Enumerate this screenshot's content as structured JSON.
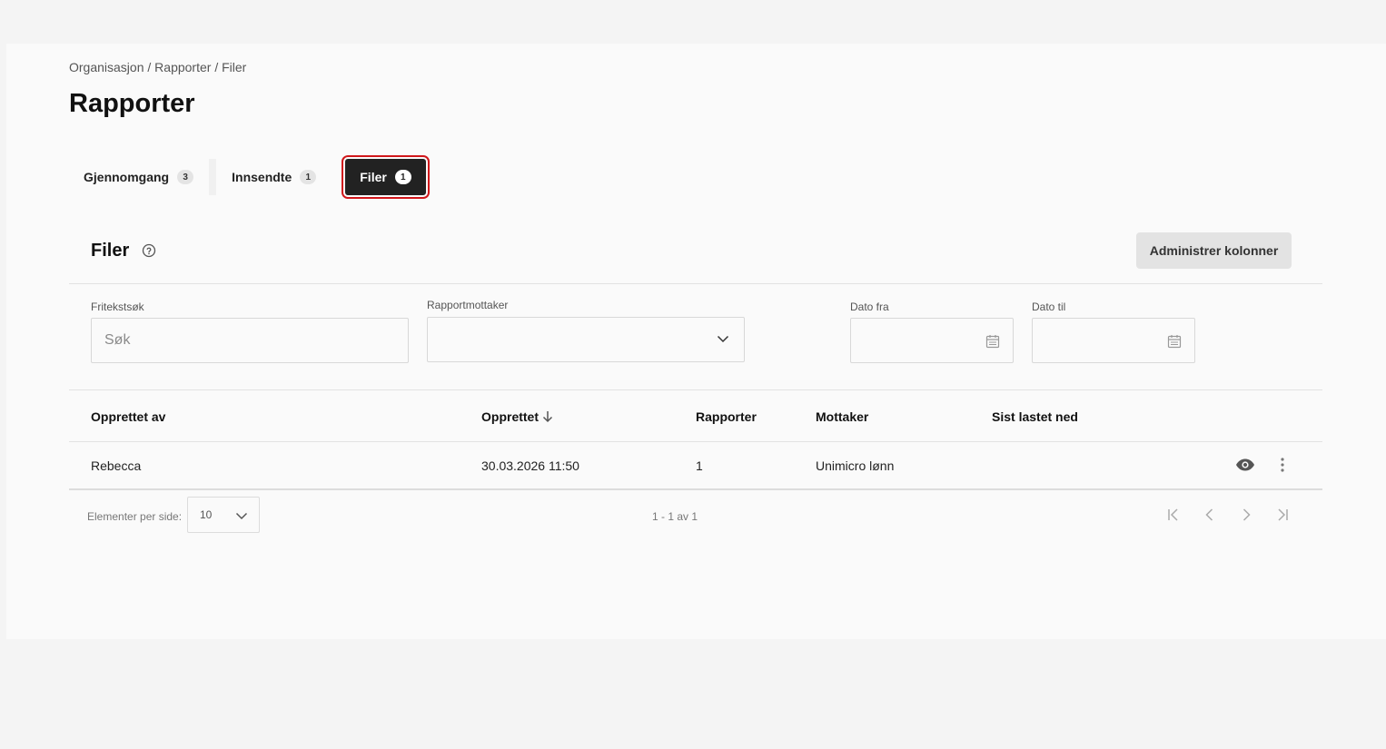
{
  "breadcrumb": [
    "Organisasjon",
    "Rapporter",
    "Filer"
  ],
  "breadcrumb_sep": " / ",
  "page_title": "Rapporter",
  "tabs": [
    {
      "label": "Gjennomgang",
      "count": "3"
    },
    {
      "label": "Innsendte",
      "count": "1"
    },
    {
      "label": "Filer",
      "count": "1",
      "active": true
    }
  ],
  "card": {
    "title": "Filer",
    "help_icon": "question-circle-icon",
    "admin_button": "Administrer kolonner"
  },
  "filters": {
    "search_label": "Fritekstsøk",
    "search_placeholder": "Søk",
    "recipient_label": "Rapportmottaker",
    "recipient_value": "",
    "date_from_label": "Dato fra",
    "date_to_label": "Dato til"
  },
  "table": {
    "columns": [
      "Opprettet av",
      "Opprettet",
      "Rapporter",
      "Mottaker",
      "Sist lastet ned"
    ],
    "sort_column": "Opprettet",
    "rows": [
      {
        "created_by": "Rebecca",
        "created": "30.03.2026 11:50",
        "reports": "1",
        "recipient": "Unimicro lønn",
        "last_downloaded": ""
      }
    ]
  },
  "pager": {
    "per_page_label": "Elementer per side:",
    "per_page_value": "10",
    "range": "1 - 1 av 1"
  },
  "colors": {
    "active_tab_bg": "#222222",
    "highlight_outline": "#d0161a",
    "button_bg": "#e3e3e3"
  }
}
